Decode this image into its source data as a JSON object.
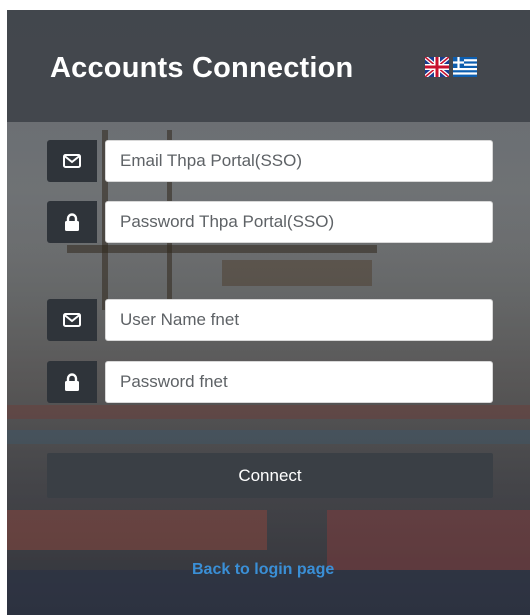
{
  "header": {
    "title": "Accounts Connection"
  },
  "languages": [
    {
      "code": "en",
      "icon": "uk-flag-icon"
    },
    {
      "code": "el",
      "icon": "greece-flag-icon"
    }
  ],
  "form": {
    "sso_email_placeholder": "Email Thpa Portal(SSO)",
    "sso_password_placeholder": "Password Thpa Portal(SSO)",
    "fnet_username_placeholder": "User Name fnet",
    "fnet_password_placeholder": "Password fnet",
    "icons": {
      "email": "envelope-icon",
      "password": "lock-icon"
    }
  },
  "actions": {
    "connect_label": "Connect",
    "back_link_label": "Back to login page"
  },
  "colors": {
    "header_bg": "#3e4248",
    "icon_box_bg": "#2f343a",
    "button_bg": "#3a3f45",
    "link": "#3a8fd6"
  }
}
